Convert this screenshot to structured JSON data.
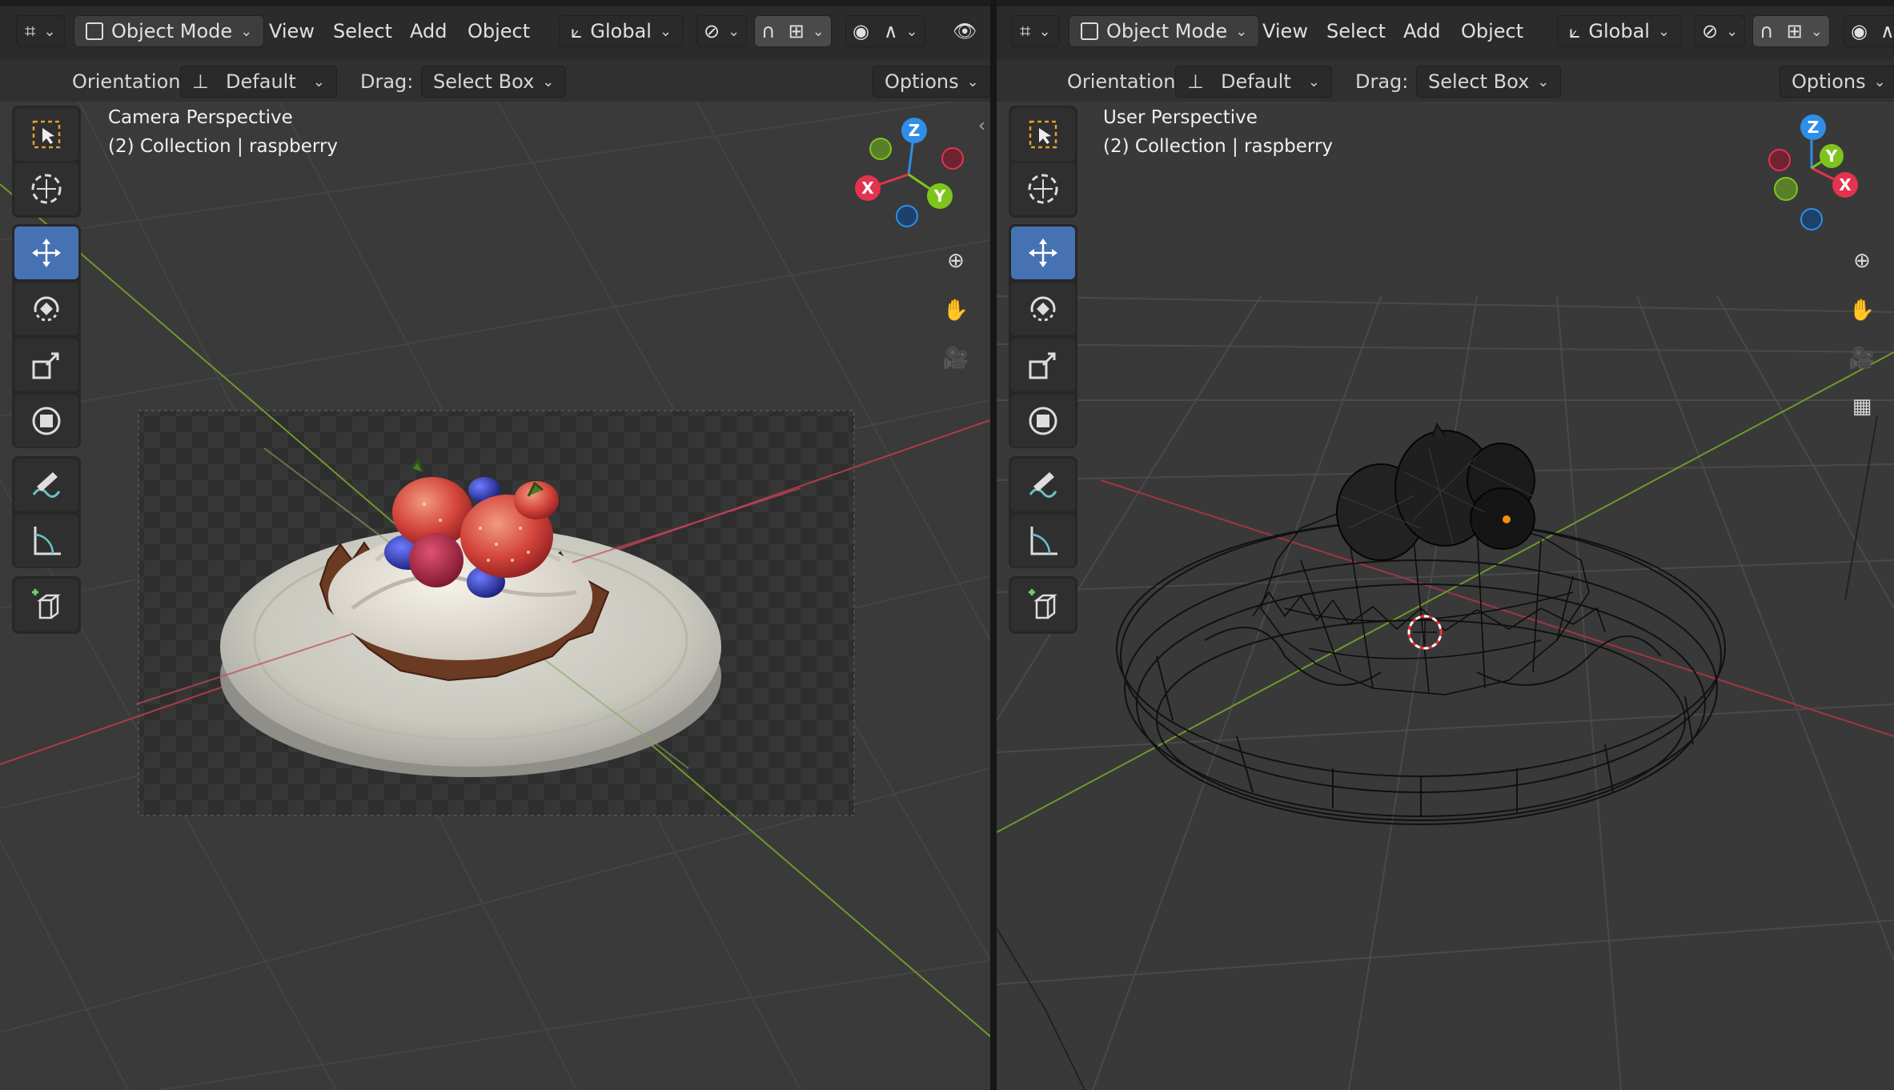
{
  "left_viewport": {
    "header": {
      "mode_label": "Object Mode",
      "menus": [
        "View",
        "Select",
        "Add",
        "Object"
      ],
      "transform_orientation": "Global"
    },
    "tool_settings": {
      "orientation_label": "Orientation:",
      "orientation_value": "Default",
      "drag_label": "Drag:",
      "drag_value": "Select Box",
      "options_label": "Options"
    },
    "overlay": {
      "view_name": "Camera Perspective",
      "collection_info": "(2) Collection | raspberry"
    },
    "gizmo": {
      "x": "X",
      "y": "Y",
      "z": "Z"
    }
  },
  "right_viewport": {
    "header": {
      "mode_label": "Object Mode",
      "menus": [
        "View",
        "Select",
        "Add",
        "Object"
      ],
      "transform_orientation": "Global"
    },
    "tool_settings": {
      "orientation_label": "Orientation:",
      "orientation_value": "Default",
      "drag_label": "Drag:",
      "drag_value": "Select Box",
      "options_label": "Options"
    },
    "overlay": {
      "view_name": "User Perspective",
      "collection_info": "(2) Collection | raspberry"
    },
    "gizmo": {
      "x": "X",
      "y": "Y",
      "z": "Z"
    }
  },
  "toolbar_tools": [
    "select-box",
    "cursor",
    "move",
    "rotate",
    "scale",
    "transform",
    "annotate",
    "measure",
    "add-cube"
  ],
  "colors": {
    "axis_x": "#e3334f",
    "axis_y": "#7fc41d",
    "axis_z": "#2f8ee7",
    "active_tool": "#4672b4",
    "header_bg": "#2b2b2b"
  }
}
